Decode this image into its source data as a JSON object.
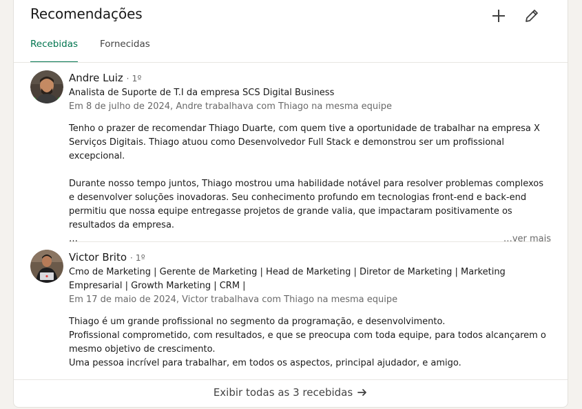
{
  "section": {
    "title": "Recomendações",
    "add_icon": "plus-icon",
    "edit_icon": "pencil-icon"
  },
  "tabs": [
    {
      "label": "Recebidas",
      "active": true
    },
    {
      "label": "Fornecidas",
      "active": false
    }
  ],
  "colors": {
    "accent": "#01754f",
    "muted": "#666666"
  },
  "recommendations": [
    {
      "name": "Andre Luiz",
      "degree": "· 1º",
      "headline": "Analista de Suporte de T.I da empresa SCS Digital Business",
      "meta": "Em 8 de julho de 2024, Andre trabalhava com Thiago na mesma equipe",
      "paragraphs": [
        "Tenho o prazer de recomendar Thiago Duarte, com quem tive a oportunidade de trabalhar na empresa X Serviços Digitais. Thiago atuou como Desenvolvedor Full Stack e demonstrou ser um profissional excepcional.",
        "Durante nosso tempo juntos, Thiago mostrou uma habilidade notável para resolver problemas complexos e desenvolver soluções inovadoras. Seu conhecimento profundo em tecnologias front-end e back-end permitiu que nossa equipe entregasse projetos de grande valia, que impactaram positivamente os resultados da empresa."
      ],
      "ellipsis": "…",
      "see_more": "…ver mais"
    },
    {
      "name": "Victor Brito",
      "degree": "· 1º",
      "headline": "Cmo de Marketing | Gerente de Marketing | Head de Marketing | Diretor de Marketing | Marketing Empresarial | Growth Marketing | CRM |",
      "meta": "Em 17 de maio de 2024, Victor trabalhava com Thiago na mesma equipe",
      "lines": [
        "Thiago é um grande profissional no segmento da programação, e desenvolvimento.",
        "Profissional comprometido, com resultados, e que se preocupa com toda equipe, para todos alcançarem o mesmo objetivo de crescimento.",
        "Uma pessoa incrível para trabalhar, em todos os aspectos, principal ajudador, e amigo."
      ]
    }
  ],
  "footer": {
    "label": "Exibir todas as 3 recebidas",
    "arrow_icon": "arrow-right-icon"
  }
}
